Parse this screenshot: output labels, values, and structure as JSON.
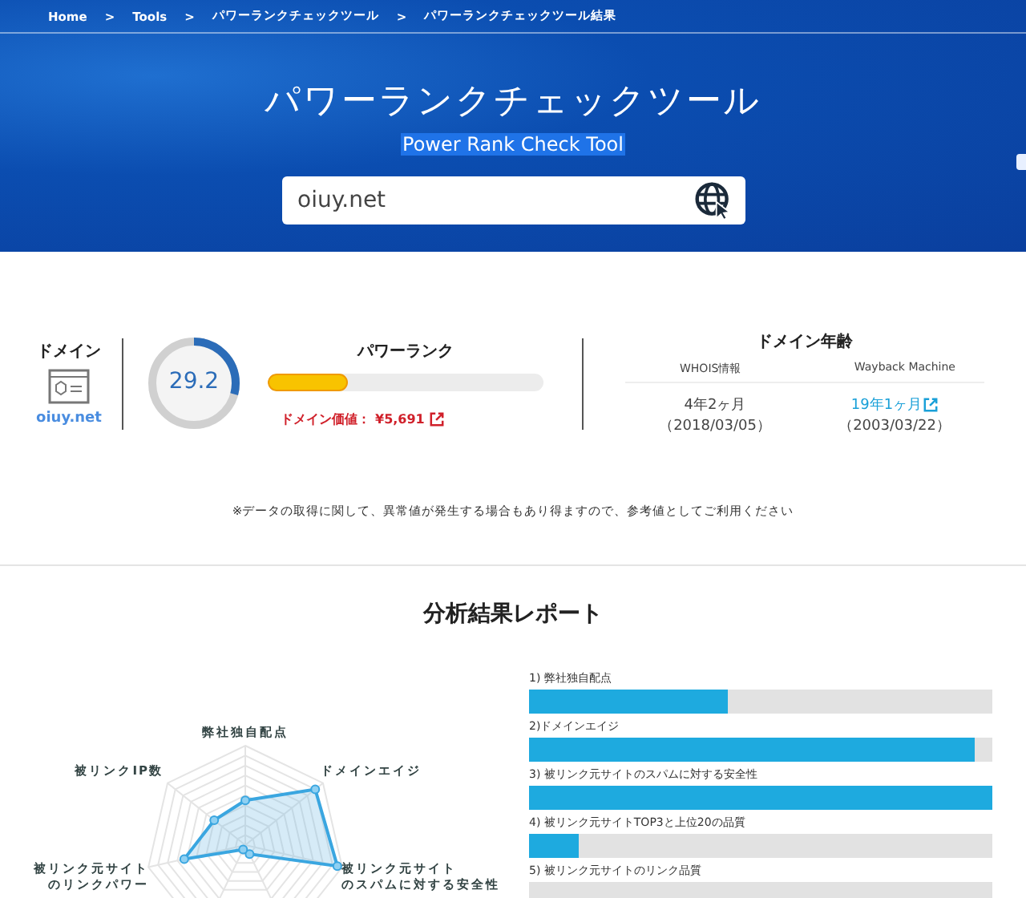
{
  "breadcrumb": [
    "Home",
    "Tools",
    "パワーランクチェックツール",
    "パワーランクチェックツール結果"
  ],
  "breadcrumb_separator": ">",
  "hero": {
    "title": "パワーランクチェックツール",
    "subtitle": "Power Rank Check Tool",
    "search": {
      "value": "oiuy.net"
    }
  },
  "domain": {
    "heading": "ドメイン",
    "name": "oiuy.net"
  },
  "score": {
    "value": "29.2",
    "level": 0.292
  },
  "power_rank": {
    "heading": "パワーランク",
    "level": 0.29,
    "value_label": "ドメイン価値：",
    "value": "¥5,691"
  },
  "domain_age": {
    "heading": "ドメイン年齢",
    "columns": [
      {
        "label": "WHOIS情報",
        "age": "4年2ヶ月",
        "date": "（2018/03/05）",
        "link": false
      },
      {
        "label": "Wayback Machine",
        "age": "19年1ヶ月",
        "date": "（2003/03/22）",
        "link": true
      }
    ]
  },
  "note": "※データの取得に関して、異常値が発生する場合もあり得ますので、参考値としてご利用ください",
  "report": {
    "title": "分析結果レポート",
    "radar_labels": [
      [
        "弊社独自配点"
      ],
      [
        "被リンクIP数"
      ],
      [
        "ドメインエイジ"
      ],
      [
        "被リンク元サイト",
        "のリンクパワー"
      ],
      [
        "被リンク元サイト",
        "のスパムに対する安全性"
      ]
    ],
    "bars": [
      {
        "label": "1) 弊社独自配点",
        "level": 0.43
      },
      {
        "label": "2)ドメインエイジ",
        "level": 0.963
      },
      {
        "label": "3) 被リンク元サイトのスパムに対する安全性",
        "level": 1.0
      },
      {
        "label": "4) 被リンク元サイトTOP3と上位20の品質",
        "level": 0.107
      },
      {
        "label": "5) 被リンク元サイトのリンク品質"
      }
    ]
  }
}
